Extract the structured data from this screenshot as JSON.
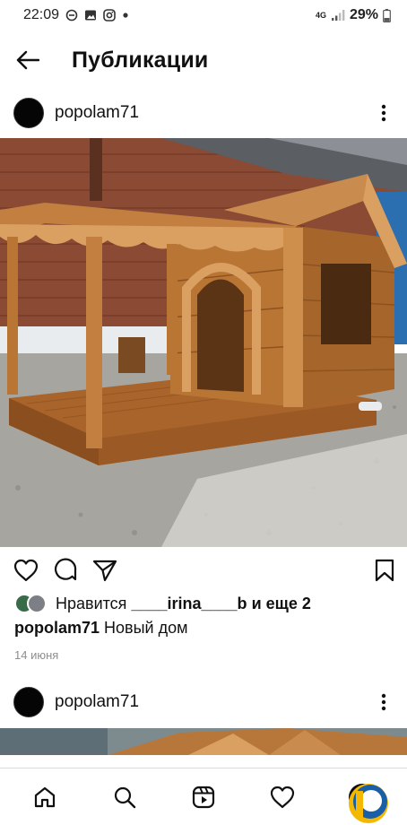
{
  "status_bar": {
    "time": "22:09",
    "network": "4G",
    "battery": "29%",
    "icons": [
      "minus-circle-icon",
      "gallery-icon",
      "instagram-icon",
      "dot-icon",
      "signal-icon",
      "battery-icon"
    ]
  },
  "header": {
    "title": "Публикации",
    "back_icon": "arrow-left-icon"
  },
  "posts": [
    {
      "username": "popolam71",
      "likes": {
        "prefix": "Нравится",
        "user": "____irina____b",
        "middle": "и",
        "more": "еще 2"
      },
      "caption": {
        "user": "popolam71",
        "text": "Новый дом"
      },
      "date": "14 июня"
    },
    {
      "username": "popolam71"
    }
  ],
  "actions": {
    "icons": [
      "heart-icon",
      "comment-icon",
      "share-icon",
      "bookmark-icon"
    ]
  },
  "bottom_nav": {
    "icons": [
      "home-icon",
      "search-icon",
      "reels-icon",
      "heart-icon",
      "profile-avatar"
    ]
  },
  "colors": {
    "text": "#111111",
    "muted": "#8e8e8e",
    "wood": "#b36d2c",
    "brick": "#8a4a34"
  }
}
